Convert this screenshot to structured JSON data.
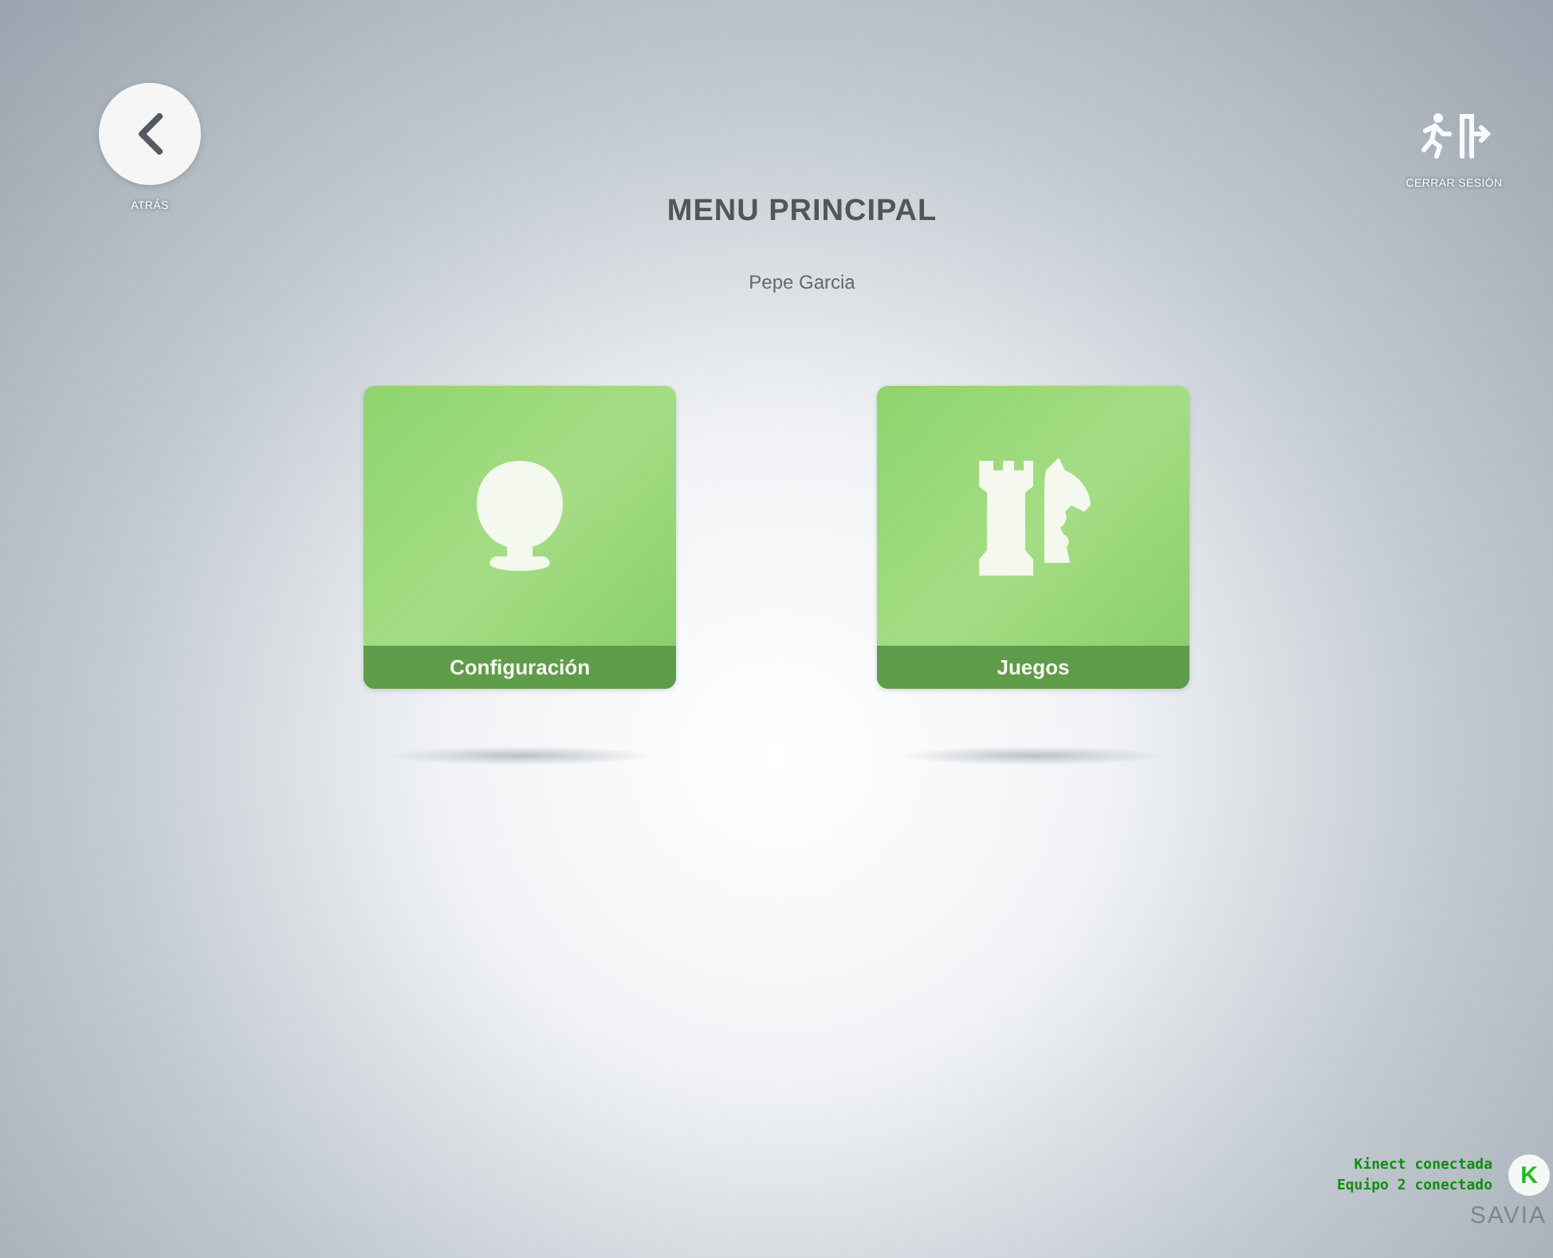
{
  "back_button": {
    "label": "ATRÁS"
  },
  "logout_button": {
    "label": "CERRAR SESIÓN"
  },
  "title": "MENU PRINCIPAL",
  "user_name": "Pepe Garcia",
  "tiles": [
    {
      "kind": "profile",
      "label": "Configuración"
    },
    {
      "kind": "games",
      "label": "Juegos"
    }
  ],
  "status": {
    "lines": [
      "Kinect conectada",
      "Equipo 2 conectado"
    ],
    "badge": "K"
  },
  "logo": "SAVIA"
}
